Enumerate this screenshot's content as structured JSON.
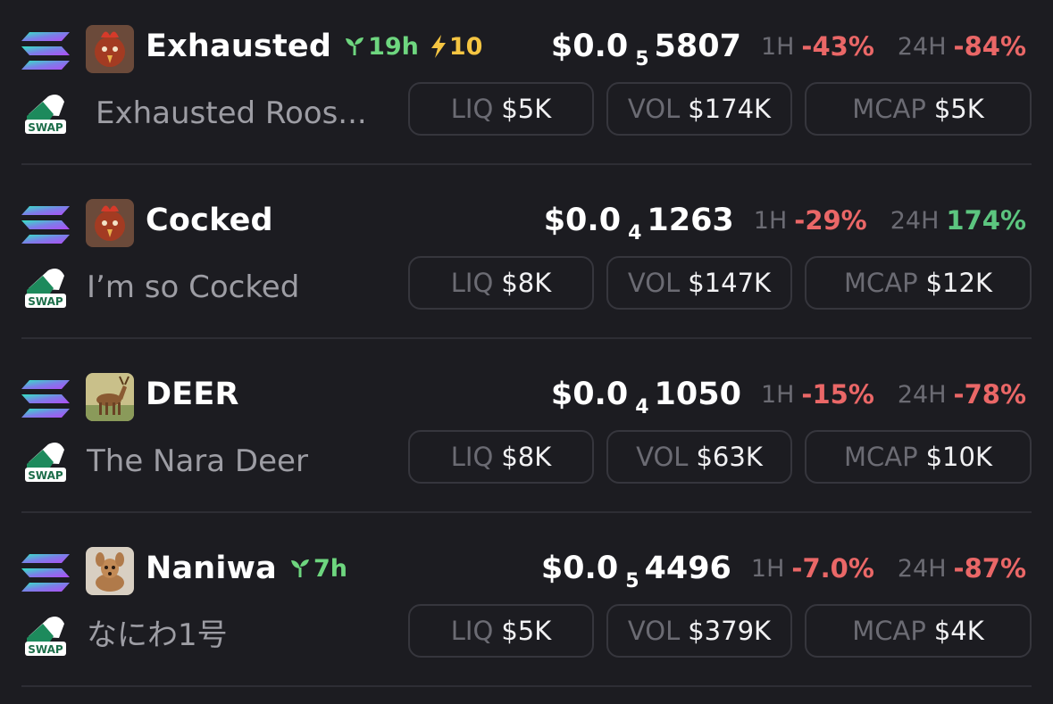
{
  "colors": {
    "background": "#1c1c21",
    "negative": "#ea6767",
    "positive": "#5cc57f",
    "age_green": "#6ed67f",
    "boost_yellow": "#f5c542"
  },
  "tokens": [
    {
      "ticker": "Exhausted",
      "name": "Exhausted Roos...",
      "age": "19h",
      "boost": "10",
      "price_prefix": "$0.0",
      "price_zeros": "5",
      "price_digits": "5807",
      "tf1": "1H",
      "chg1": "-43%",
      "tf2": "24H",
      "chg2": "-84%",
      "liq_label": "LIQ",
      "liq": "$5K",
      "vol_label": "VOL",
      "vol": "$174K",
      "mcap_label": "MCAP",
      "mcap": "$5K",
      "chain_icon": "solana-icon",
      "dex_icon": "swap-icon",
      "avatar": "rooster-avatar"
    },
    {
      "ticker": "Cocked",
      "name": "I’m so Cocked",
      "price_prefix": "$0.0",
      "price_zeros": "4",
      "price_digits": "1263",
      "tf1": "1H",
      "chg1": "-29%",
      "tf2": "24H",
      "chg2": "174%",
      "liq_label": "LIQ",
      "liq": "$8K",
      "vol_label": "VOL",
      "vol": "$147K",
      "mcap_label": "MCAP",
      "mcap": "$12K",
      "chain_icon": "solana-icon",
      "dex_icon": "swap-icon",
      "avatar": "rooster-avatar"
    },
    {
      "ticker": "DEER",
      "name": "The Nara Deer",
      "price_prefix": "$0.0",
      "price_zeros": "4",
      "price_digits": "1050",
      "tf1": "1H",
      "chg1": "-15%",
      "tf2": "24H",
      "chg2": "-78%",
      "liq_label": "LIQ",
      "liq": "$8K",
      "vol_label": "VOL",
      "vol": "$63K",
      "mcap_label": "MCAP",
      "mcap": "$10K",
      "chain_icon": "solana-icon",
      "dex_icon": "swap-icon",
      "avatar": "deer-avatar"
    },
    {
      "ticker": "Naniwa",
      "name": "なにわ1号",
      "age": "7h",
      "price_prefix": "$0.0",
      "price_zeros": "5",
      "price_digits": "4496",
      "tf1": "1H",
      "chg1": "-7.0%",
      "tf2": "24H",
      "chg2": "-87%",
      "liq_label": "LIQ",
      "liq": "$5K",
      "vol_label": "VOL",
      "vol": "$379K",
      "mcap_label": "MCAP",
      "mcap": "$4K",
      "chain_icon": "solana-icon",
      "dex_icon": "swap-icon",
      "avatar": "fawn-avatar"
    }
  ]
}
